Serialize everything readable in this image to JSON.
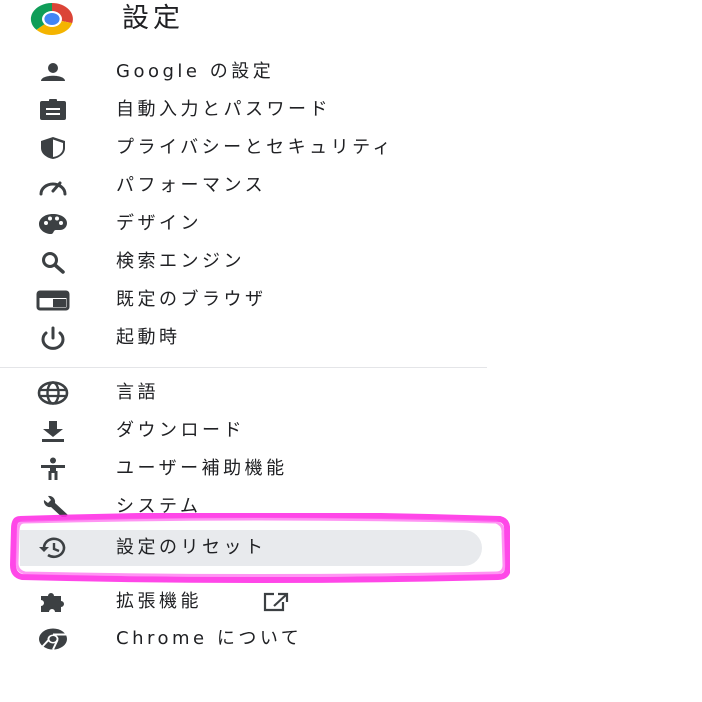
{
  "header": {
    "title": "設定",
    "logo_icon": "chrome-logo-icon"
  },
  "colors": {
    "text": "#202124",
    "icon": "#3c4043",
    "selected_bg": "#e8eaed",
    "divider": "#e4e5e8",
    "annotation": "#ff33e6"
  },
  "menu": {
    "items": [
      {
        "label": "Google の設定",
        "icon": "person-icon"
      },
      {
        "label": "自動入力とパスワード",
        "icon": "clipboard-icon"
      },
      {
        "label": "プライバシーとセキュリティ",
        "icon": "shield-icon"
      },
      {
        "label": "パフォーマンス",
        "icon": "speedometer-icon"
      },
      {
        "label": "デザイン",
        "icon": "palette-icon"
      },
      {
        "label": "検索エンジン",
        "icon": "search-icon"
      },
      {
        "label": "既定のブラウザ",
        "icon": "browser-window-icon"
      },
      {
        "label": "起動時",
        "icon": "power-icon"
      }
    ],
    "advanced_items": [
      {
        "label": "言語",
        "icon": "globe-icon"
      },
      {
        "label": "ダウンロード",
        "icon": "download-icon"
      },
      {
        "label": "ユーザー補助機能",
        "icon": "accessibility-icon"
      },
      {
        "label": "システム",
        "icon": "wrench-icon"
      },
      {
        "label": "設定のリセット",
        "icon": "restore-icon",
        "selected": true
      }
    ],
    "extensions": {
      "label": "拡張機能",
      "icon": "puzzle-icon",
      "external_icon": "open-in-new-icon"
    },
    "about": {
      "label": "Chrome について",
      "icon": "chrome-outline-icon"
    }
  }
}
